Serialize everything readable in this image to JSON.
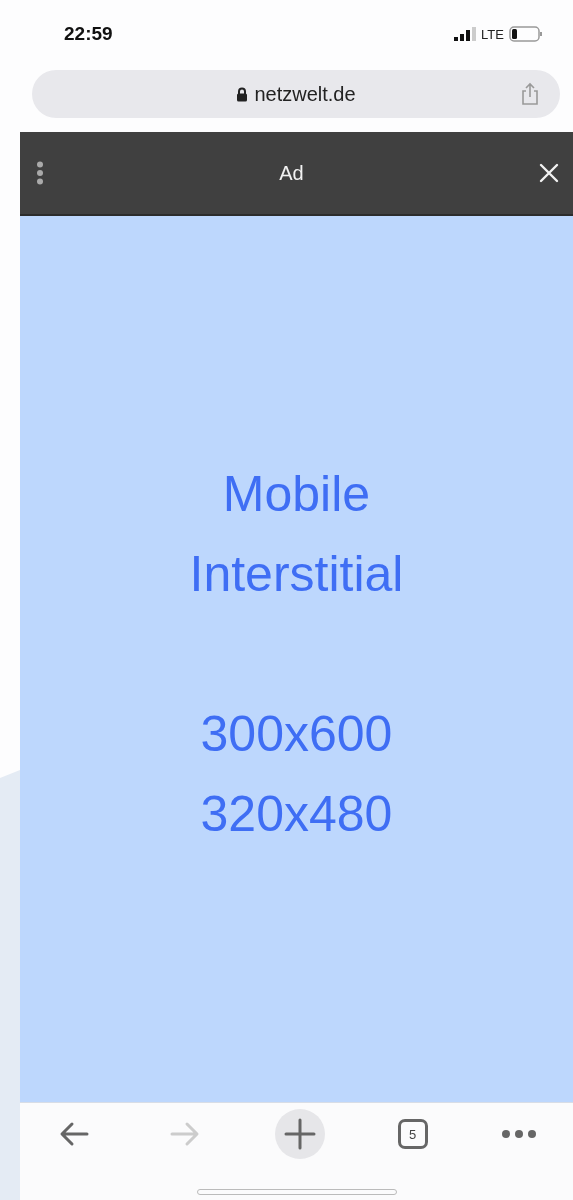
{
  "status_bar": {
    "time": "22:59",
    "network": "LTE"
  },
  "address_bar": {
    "url": "netzwelt.de"
  },
  "ad_header": {
    "title": "Ad"
  },
  "ad": {
    "title": "Mobile Interstitial",
    "sizes": [
      "300x600",
      "320x480"
    ]
  },
  "toolbar": {
    "back": {
      "disabled": false
    },
    "forward": {
      "disabled": true
    },
    "tab_count": "5"
  }
}
